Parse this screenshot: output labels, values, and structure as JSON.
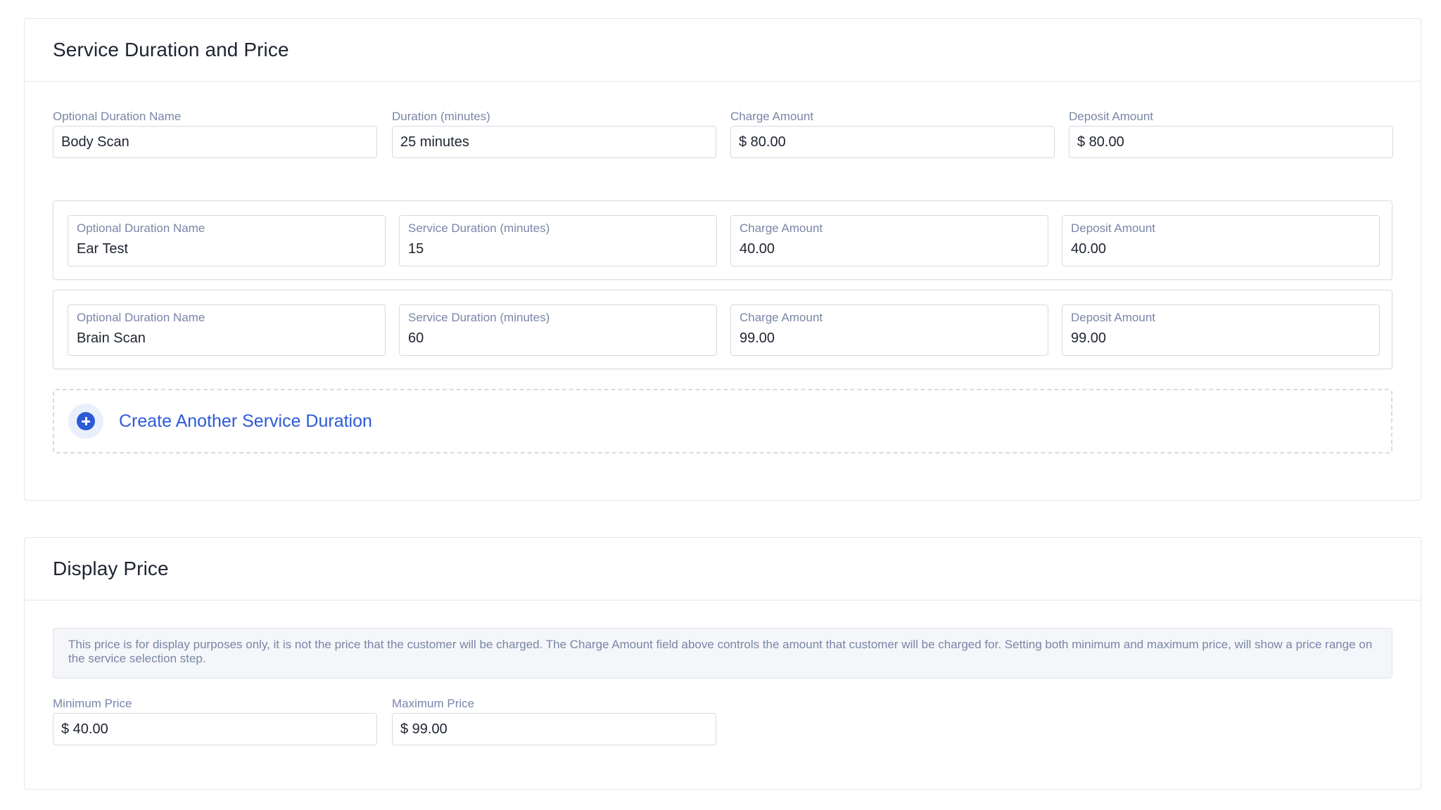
{
  "duration_section": {
    "title": "Service Duration and Price",
    "primary": {
      "name_label": "Optional Duration Name",
      "name_value": "Body Scan",
      "duration_label": "Duration (minutes)",
      "duration_value": "25 minutes",
      "charge_label": "Charge Amount",
      "charge_value": "$ 80.00",
      "deposit_label": "Deposit Amount",
      "deposit_value": "$ 80.00"
    },
    "extra_durations": [
      {
        "name_label": "Optional Duration Name",
        "name_value": "Ear Test",
        "duration_label": "Service Duration (minutes)",
        "duration_value": "15",
        "charge_label": "Charge Amount",
        "charge_value": "40.00",
        "deposit_label": "Deposit Amount",
        "deposit_value": "40.00"
      },
      {
        "name_label": "Optional Duration Name",
        "name_value": "Brain Scan",
        "duration_label": "Service Duration (minutes)",
        "duration_value": "60",
        "charge_label": "Charge Amount",
        "charge_value": "99.00",
        "deposit_label": "Deposit Amount",
        "deposit_value": "99.00"
      }
    ],
    "create_label": "Create Another Service Duration",
    "create_icon": "plus-circle-icon"
  },
  "display_price_section": {
    "title": "Display Price",
    "notice": "This price is for display purposes only, it is not the price that the customer will be charged. The Charge Amount field above controls the amount that customer will be charged for. Setting both minimum and maximum price, will show a price range on the service selection step.",
    "min_label": "Minimum Price",
    "min_value": "$ 40.00",
    "max_label": "Maximum Price",
    "max_value": "$ 99.00"
  },
  "colors": {
    "accent": "#2d5bd6",
    "label": "#7a86a7",
    "border": "#d6dae2"
  }
}
